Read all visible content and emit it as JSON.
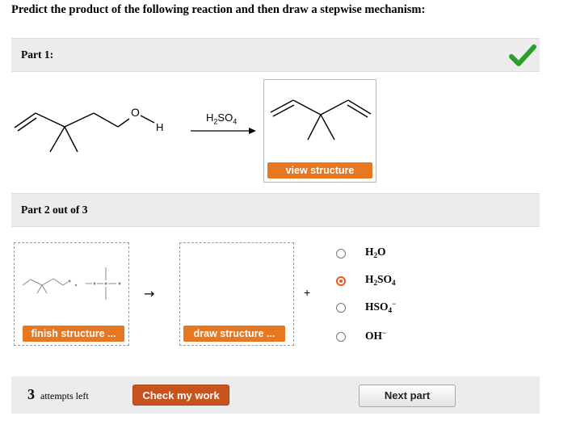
{
  "heading": "Predict the product of the following reaction and then draw a stepwise mechanism:",
  "part1": {
    "label": "Part 1:",
    "status": "correct",
    "reactant_atoms": {
      "oxygen": "O",
      "hydrogen": "H"
    },
    "reagent": {
      "main": "H",
      "sub": "2",
      "rest": "SO",
      "sub2": "4"
    },
    "view_button": "view structure"
  },
  "part2": {
    "label": "Part 2 out of 3",
    "finish_button": "finish structure ...",
    "draw_button": "draw structure ...",
    "plus": "+",
    "reaction_arrow": "→",
    "options": [
      {
        "main": "H",
        "sub": "2",
        "rest": "O",
        "sup": "",
        "selected": false
      },
      {
        "main": "H",
        "sub": "2",
        "rest": "SO",
        "sub2": "4",
        "sup": "",
        "selected": true
      },
      {
        "main": "HSO",
        "sub": "4",
        "rest": "",
        "sup": "−",
        "selected": false
      },
      {
        "main": "OH",
        "sub": "",
        "rest": "",
        "sup": "−",
        "selected": false
      }
    ]
  },
  "footer": {
    "attempts_count": "3",
    "attempts_text": "attempts left",
    "check_button": "Check my work",
    "next_button": "Next part"
  },
  "colors": {
    "accent_orange": "#e87722",
    "check_green": "#2aa02a",
    "radio_selected": "#e85a1e"
  }
}
